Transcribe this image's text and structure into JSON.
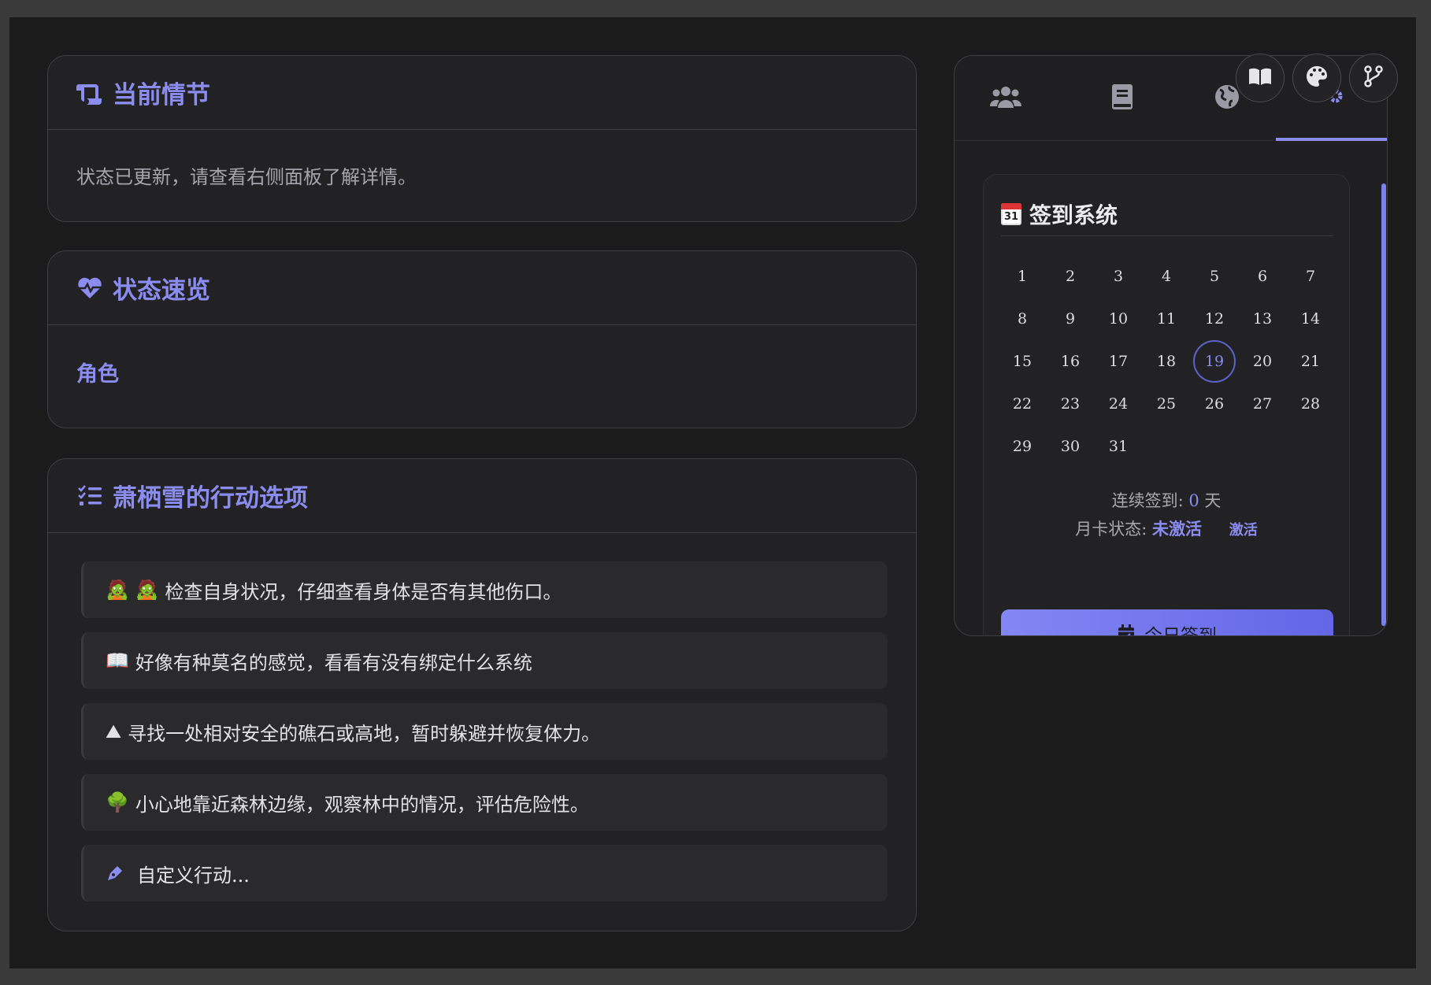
{
  "story": {
    "title": "当前情节",
    "text": "状态已更新，请查看右侧面板了解详情。"
  },
  "status": {
    "title": "状态速览",
    "role_label": "角色"
  },
  "actions": {
    "title": "萧栖雪的行动选项",
    "items": [
      {
        "emoji": "🧟 🧟",
        "text": "检查自身状况，仔细查看身体是否有其他伤口。"
      },
      {
        "emoji": "📖",
        "text": "好像有种莫名的感觉，看看有没有绑定什么系统"
      },
      {
        "emoji": "⛰",
        "text": "寻找一处相对安全的礁石或高地，暂时躲避并恢复体力。"
      },
      {
        "emoji": "🌳",
        "text": "小心地靠近森林边缘，观察林中的情况，评估危险性。"
      }
    ],
    "custom_label": "自定义行动..."
  },
  "side": {
    "tabs": [
      "users-icon",
      "book-icon",
      "globe-icon",
      "gears-icon"
    ],
    "active_tab": 3
  },
  "checkin": {
    "title": "签到系统",
    "calendar_icon_text": "31",
    "days": [
      "1",
      "2",
      "3",
      "4",
      "5",
      "6",
      "7",
      "8",
      "9",
      "10",
      "11",
      "12",
      "13",
      "14",
      "15",
      "16",
      "17",
      "18",
      "19",
      "20",
      "21",
      "22",
      "23",
      "24",
      "25",
      "26",
      "27",
      "28",
      "29",
      "30",
      "31"
    ],
    "today": "19",
    "streak_label": "连续签到:",
    "streak_value": "0",
    "streak_unit": "天",
    "card_label": "月卡状态:",
    "card_value": "未激活",
    "activate_label": "激活",
    "button_label": "今日签到"
  },
  "floating": [
    "book-open-icon",
    "palette-icon",
    "branch-icon"
  ],
  "colors": {
    "accent": "#8a8cf0",
    "background": "#1b1b1c",
    "card": "#222224"
  }
}
